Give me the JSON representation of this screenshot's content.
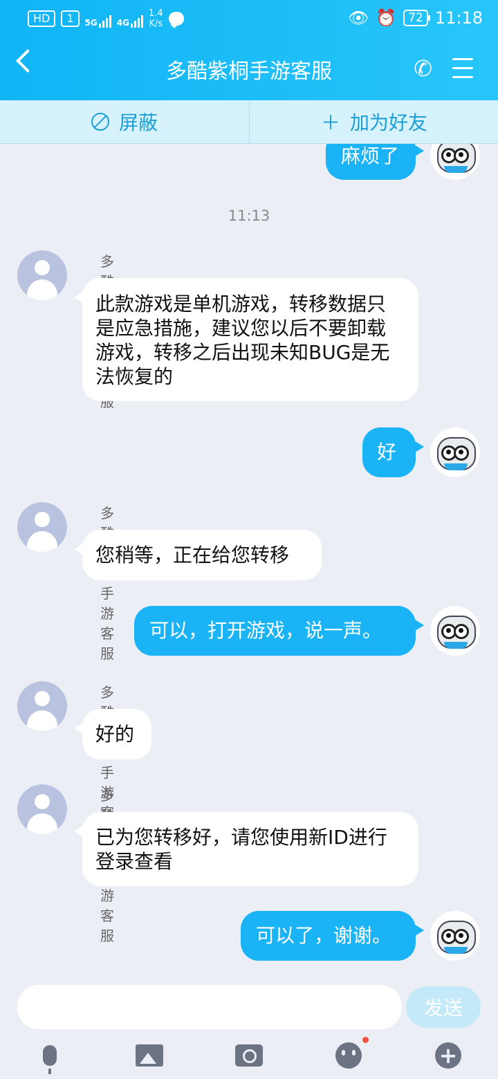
{
  "status_bar": {
    "hd": "HD",
    "sim": "1",
    "net1": "5G",
    "net2": "4G",
    "speed_value": "1.4",
    "speed_unit": "K/s",
    "battery": "72",
    "time": "11:18"
  },
  "header": {
    "title": "多酷紫桐手游客服"
  },
  "actions": {
    "block_label": "屏蔽",
    "add_friend_label": "加为好友"
  },
  "chat": {
    "timestamp": "11:13",
    "messages": [
      {
        "side": "out",
        "text": "麻烦了"
      },
      {
        "side": "in",
        "sender": "多酷紫桐手游客服",
        "text": "此款游戏是单机游戏，转移数据只是应急措施，建议您以后不要卸载游戏，转移之后出现未知BUG是无法恢复的"
      },
      {
        "side": "out",
        "text": "好"
      },
      {
        "side": "in",
        "sender": "多酷紫桐手游客服",
        "text": "您稍等，正在给您转移"
      },
      {
        "side": "out",
        "text": "可以，打开游戏，说一声。"
      },
      {
        "side": "in",
        "sender": "多酷紫桐手游客服",
        "text": "好的"
      },
      {
        "side": "in",
        "sender": "多酷紫桐手游客服",
        "text": "已为您转移好，请您使用新ID进行登录查看"
      },
      {
        "side": "out",
        "text": "可以了，谢谢。"
      }
    ]
  },
  "composer": {
    "input_value": "",
    "send_label": "发送"
  },
  "colors": {
    "header_blue": "#1ab3f5",
    "outgoing_bubble": "#1ab3f5",
    "incoming_bubble": "#ffffff",
    "background": "#ebeef5"
  }
}
